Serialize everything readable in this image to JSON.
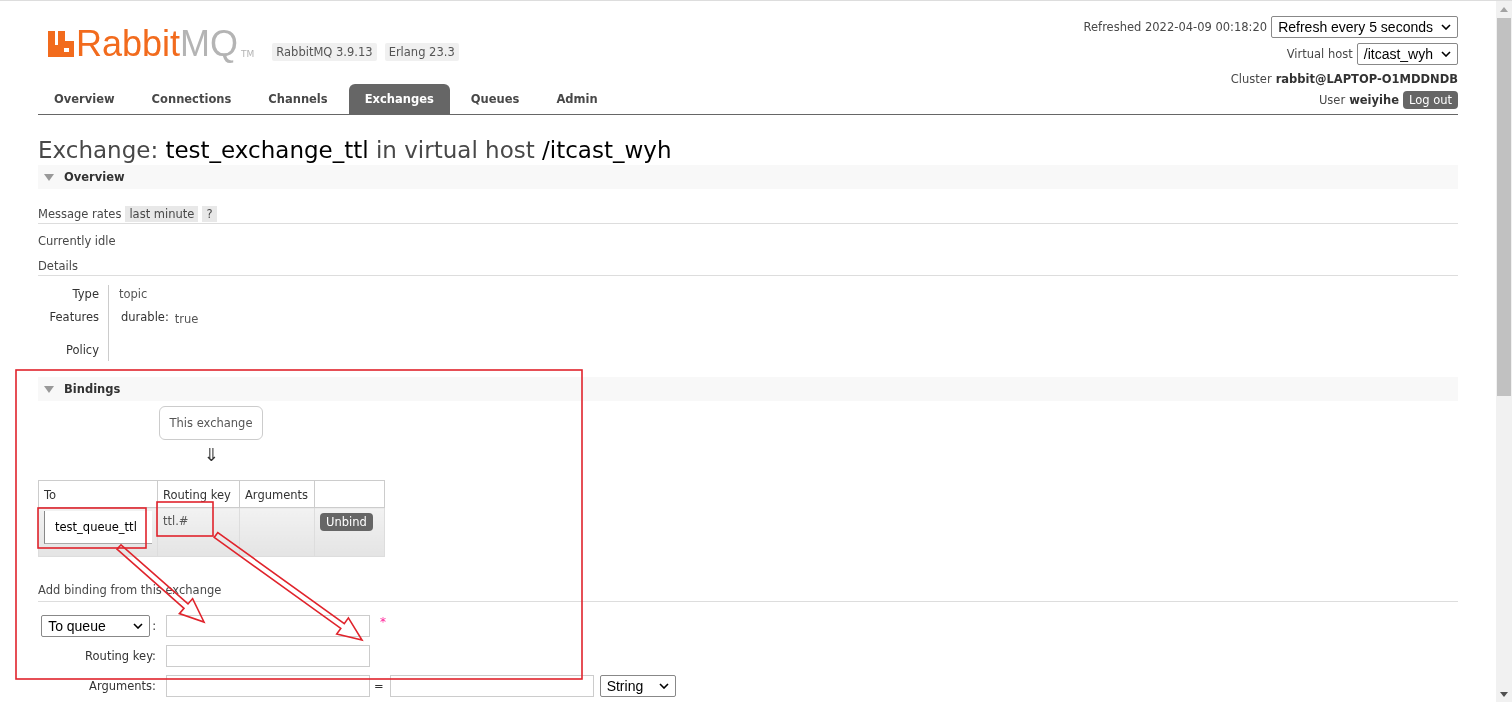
{
  "header": {
    "logo_primary": "Rabbit",
    "logo_secondary": "MQ",
    "trademark": "TM",
    "versions": [
      "RabbitMQ 3.9.13",
      "Erlang 23.3"
    ],
    "refreshed": "Refreshed 2022-04-09 00:18:20",
    "refresh_select": "Refresh every 5 seconds",
    "virtual_host": {
      "label": "Virtual host",
      "value": "/itcast_wyh"
    },
    "cluster": {
      "label": "Cluster",
      "value": "rabbit@LAPTOP-O1MDDNDB"
    },
    "user": {
      "label": "User",
      "value": "weiyihe"
    },
    "logout": "Log out"
  },
  "tabs": [
    {
      "label": "Overview",
      "selected": false
    },
    {
      "label": "Connections",
      "selected": false
    },
    {
      "label": "Channels",
      "selected": false
    },
    {
      "label": "Exchanges",
      "selected": true
    },
    {
      "label": "Queues",
      "selected": false
    },
    {
      "label": "Admin",
      "selected": false
    }
  ],
  "title": "Exchange: **test_exchange_ttl** in virtual host **/itcast_wyh**",
  "overview": {
    "heading": "Overview",
    "expanded": true,
    "message_rates": {
      "label": "Message rates",
      "period": "last minute",
      "help": "?"
    },
    "status": "Currently idle",
    "details_heading": "Details",
    "details": [
      {
        "label": "Type",
        "value": "topic"
      },
      {
        "label": "Features",
        "key": "durable:",
        "value": "true"
      },
      {
        "label": "Policy"
      }
    ]
  },
  "bindings": {
    "heading": "Bindings",
    "expanded": true,
    "source": "This exchange",
    "arrow": "⇓",
    "columns": [
      "To",
      "Routing key",
      "Arguments"
    ],
    "rows": [
      {
        "to": "test_queue_ttl",
        "routing_key": "ttl.#",
        "action": "Unbind"
      }
    ]
  },
  "add_binding": {
    "heading": "Add binding from this exchange",
    "destination_type": "To queue",
    "separator": ":",
    "required_mark": "*",
    "routing_key_label": "Routing key:",
    "arguments_label": "Arguments:",
    "equals": "=",
    "argument_type": "String"
  }
}
